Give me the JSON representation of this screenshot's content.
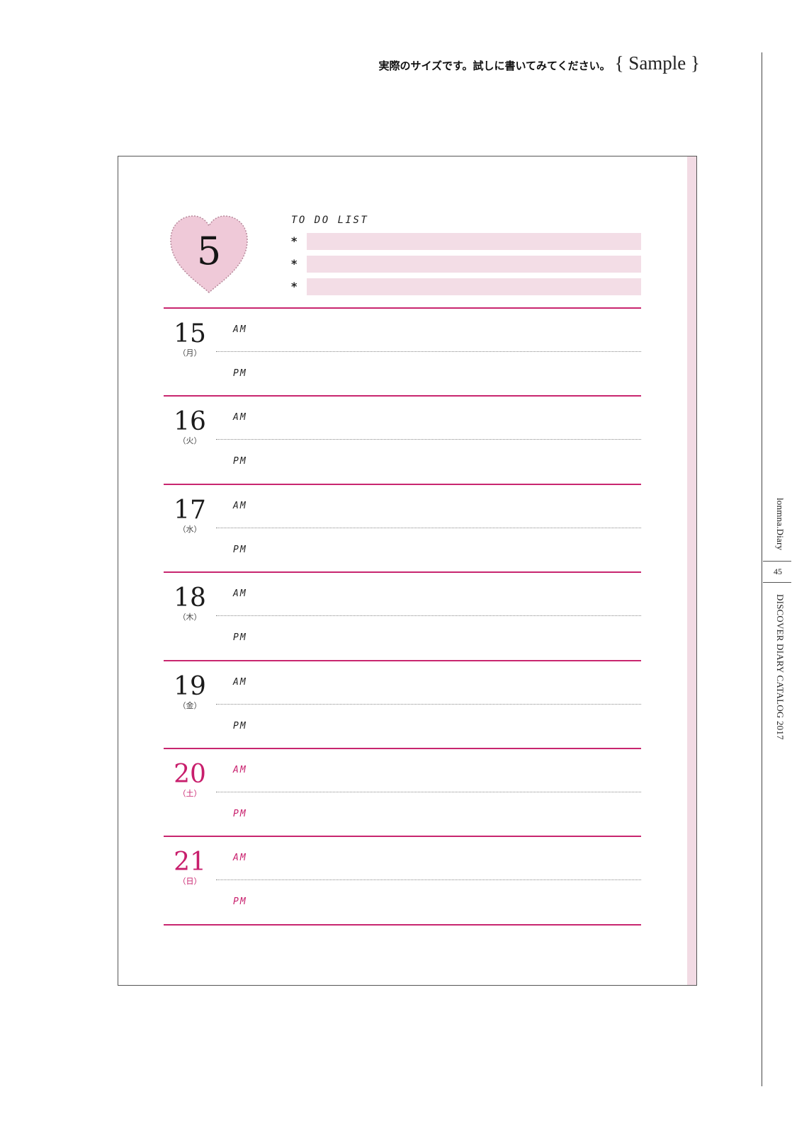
{
  "header": {
    "note_jp": "実際のサイズです。試しに書いてみてください。",
    "note_sample": "{ Sample }"
  },
  "sidebar": {
    "brand": "lonmna.Diary",
    "page_number": "45",
    "catalog": "DISCOVER DIARY CATALOG 2017"
  },
  "diary": {
    "month": "5",
    "todo_title": "TO DO LIST",
    "todo_bullet": "*",
    "todo_items": [
      "",
      "",
      ""
    ],
    "am_label": "AM",
    "pm_label": "PM",
    "days": [
      {
        "date": "15",
        "weekday": "（月）",
        "weekend": false
      },
      {
        "date": "16",
        "weekday": "（火）",
        "weekend": false
      },
      {
        "date": "17",
        "weekday": "（水）",
        "weekend": false
      },
      {
        "date": "18",
        "weekday": "（木）",
        "weekend": false
      },
      {
        "date": "19",
        "weekday": "（金）",
        "weekend": false
      },
      {
        "date": "20",
        "weekday": "（土）",
        "weekend": true
      },
      {
        "date": "21",
        "weekday": "（日）",
        "weekend": true
      }
    ]
  },
  "colors": {
    "accent_pink": "#c8266f",
    "heart_fill": "#efc9d8",
    "todo_bar": "#f3dde6"
  }
}
